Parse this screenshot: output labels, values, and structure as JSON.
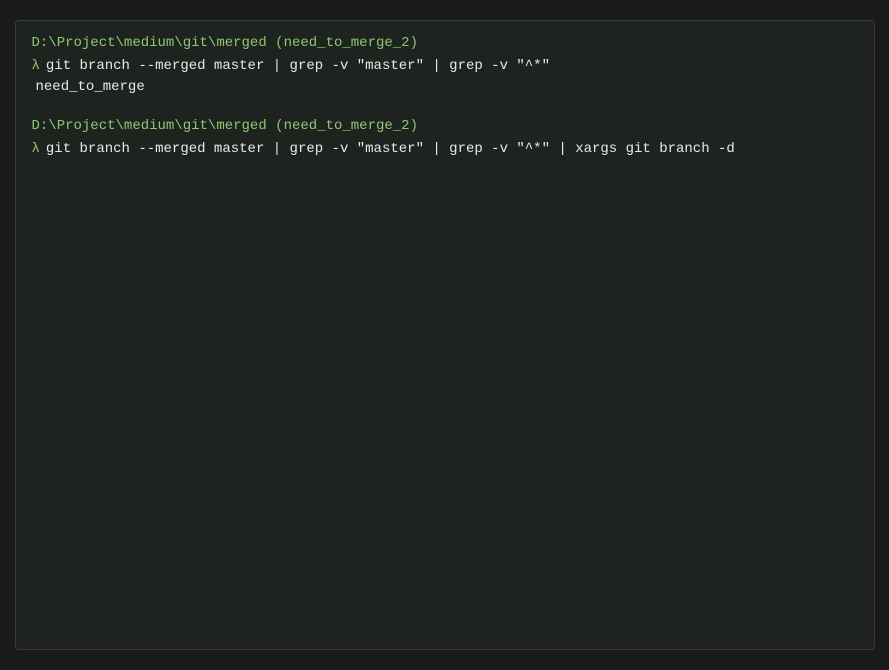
{
  "terminal": {
    "background": "#1e2320",
    "blocks": [
      {
        "id": "block1",
        "prompt": {
          "path": "D:\\Project\\medium\\git\\merged",
          "branch": "need_to_merge_2"
        },
        "command": "git branch --merged master | grep -v \"master\" | grep -v \"^*\"",
        "output": "  need_to_merge"
      },
      {
        "id": "block2",
        "prompt": {
          "path": "D:\\Project\\medium\\git\\merged",
          "branch": "need_to_merge_2"
        },
        "command": "git branch --merged master | grep -v \"master\" | grep -v \"^*\" | xargs git branch -d",
        "output": ""
      }
    ]
  }
}
